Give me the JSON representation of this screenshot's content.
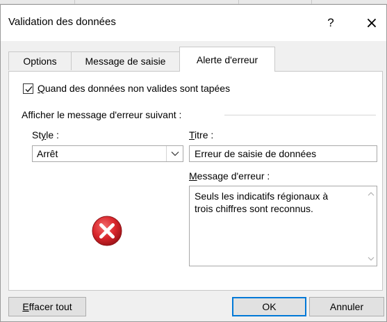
{
  "dialog": {
    "title": "Validation des données",
    "help_label": "?",
    "close_glyph": "×"
  },
  "tabs": [
    {
      "label": "Options",
      "active": false
    },
    {
      "label": "Message de saisie",
      "active": false
    },
    {
      "label": "Alerte d'erreur",
      "active": true
    }
  ],
  "alert": {
    "checkbox_label_first": "Q",
    "checkbox_label_rest": "uand des données non valides sont tapées",
    "checkbox_checked": true,
    "group_label": "Afficher le message d'erreur suivant :",
    "style_label_a": "St",
    "style_label_u": "y",
    "style_label_b": "le :",
    "style_value": "Arrêt",
    "title_label_u": "T",
    "title_label_rest": "itre :",
    "title_value": "Erreur de saisie de données",
    "message_label_u": "M",
    "message_label_rest": "essage d'erreur :",
    "message_value": "Seuls les indicatifs régionaux à\ntrois chiffres sont reconnus.",
    "icon": "error-stop-icon"
  },
  "buttons": {
    "clear_u": "E",
    "clear_rest": "ffacer tout",
    "ok": "OK",
    "cancel": "Annuler"
  },
  "colors": {
    "error_red": "#d9262c",
    "accent_blue": "#0078d7"
  }
}
